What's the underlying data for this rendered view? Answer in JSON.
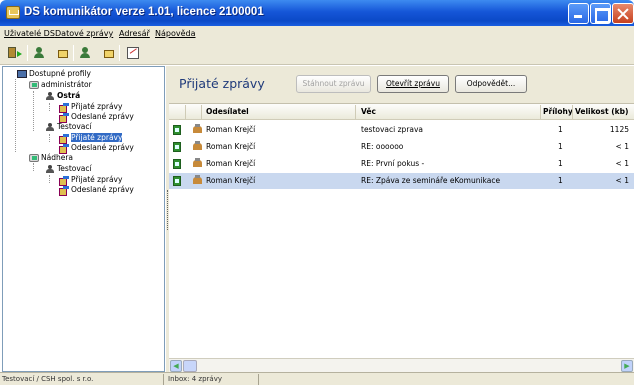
{
  "window": {
    "title": "DS komunikátor verze 1.01, licence 2100001"
  },
  "menu": [
    "Uživatelé DS",
    "Datové zprávy",
    "Adresář",
    "Nápověda"
  ],
  "toolbar": {
    "icons": [
      "exit-icon",
      "user-settings-icon",
      "user-mailbox-icon",
      "mailbox-icon",
      "mailbox-settings-icon",
      "sign-icon"
    ]
  },
  "tree": {
    "root": "Dostupné profily",
    "profiles": [
      {
        "name": "administrátor",
        "groups": [
          {
            "name": "Ostrá",
            "items": [
              "Přijaté zprávy",
              "Odeslané zprávy"
            ]
          },
          {
            "name": "Testovací",
            "items": [
              "Přijaté zprávy",
              "Odeslané zprávy"
            ]
          }
        ]
      },
      {
        "name": "Nádhera",
        "groups": [
          {
            "name": "Testovací",
            "items": [
              "Přijaté zprávy",
              "Odeslané zprávy"
            ]
          }
        ]
      }
    ]
  },
  "panel": {
    "title": "Přijaté zprávy",
    "buttons": {
      "download": "Stáhnout zprávu",
      "open": "Otevřít zprávu",
      "reply": "Odpovědět..."
    }
  },
  "table": {
    "columns": {
      "sender": "Odesílatel",
      "subject": "Věc",
      "attachments": "Přílohy",
      "size": "Velikost (kb)"
    },
    "rows": [
      {
        "sender": "Roman Krejčí",
        "subject": "testovaci zprava",
        "attachments": "1",
        "size": "1125"
      },
      {
        "sender": "Roman Krejčí",
        "subject": "RE: oooooo",
        "attachments": "1",
        "size": "< 1"
      },
      {
        "sender": "Roman Krejčí",
        "subject": "RE: První pokus -",
        "attachments": "1",
        "size": "< 1"
      },
      {
        "sender": "Roman Krejčí",
        "subject": "RE: Zpáva ze semináře eKomunikace",
        "attachments": "1",
        "size": "< 1"
      }
    ]
  },
  "status": {
    "profile": "Testovací / CSH spol. s r.o.",
    "inbox": "Inbox: 4 zprávy"
  }
}
